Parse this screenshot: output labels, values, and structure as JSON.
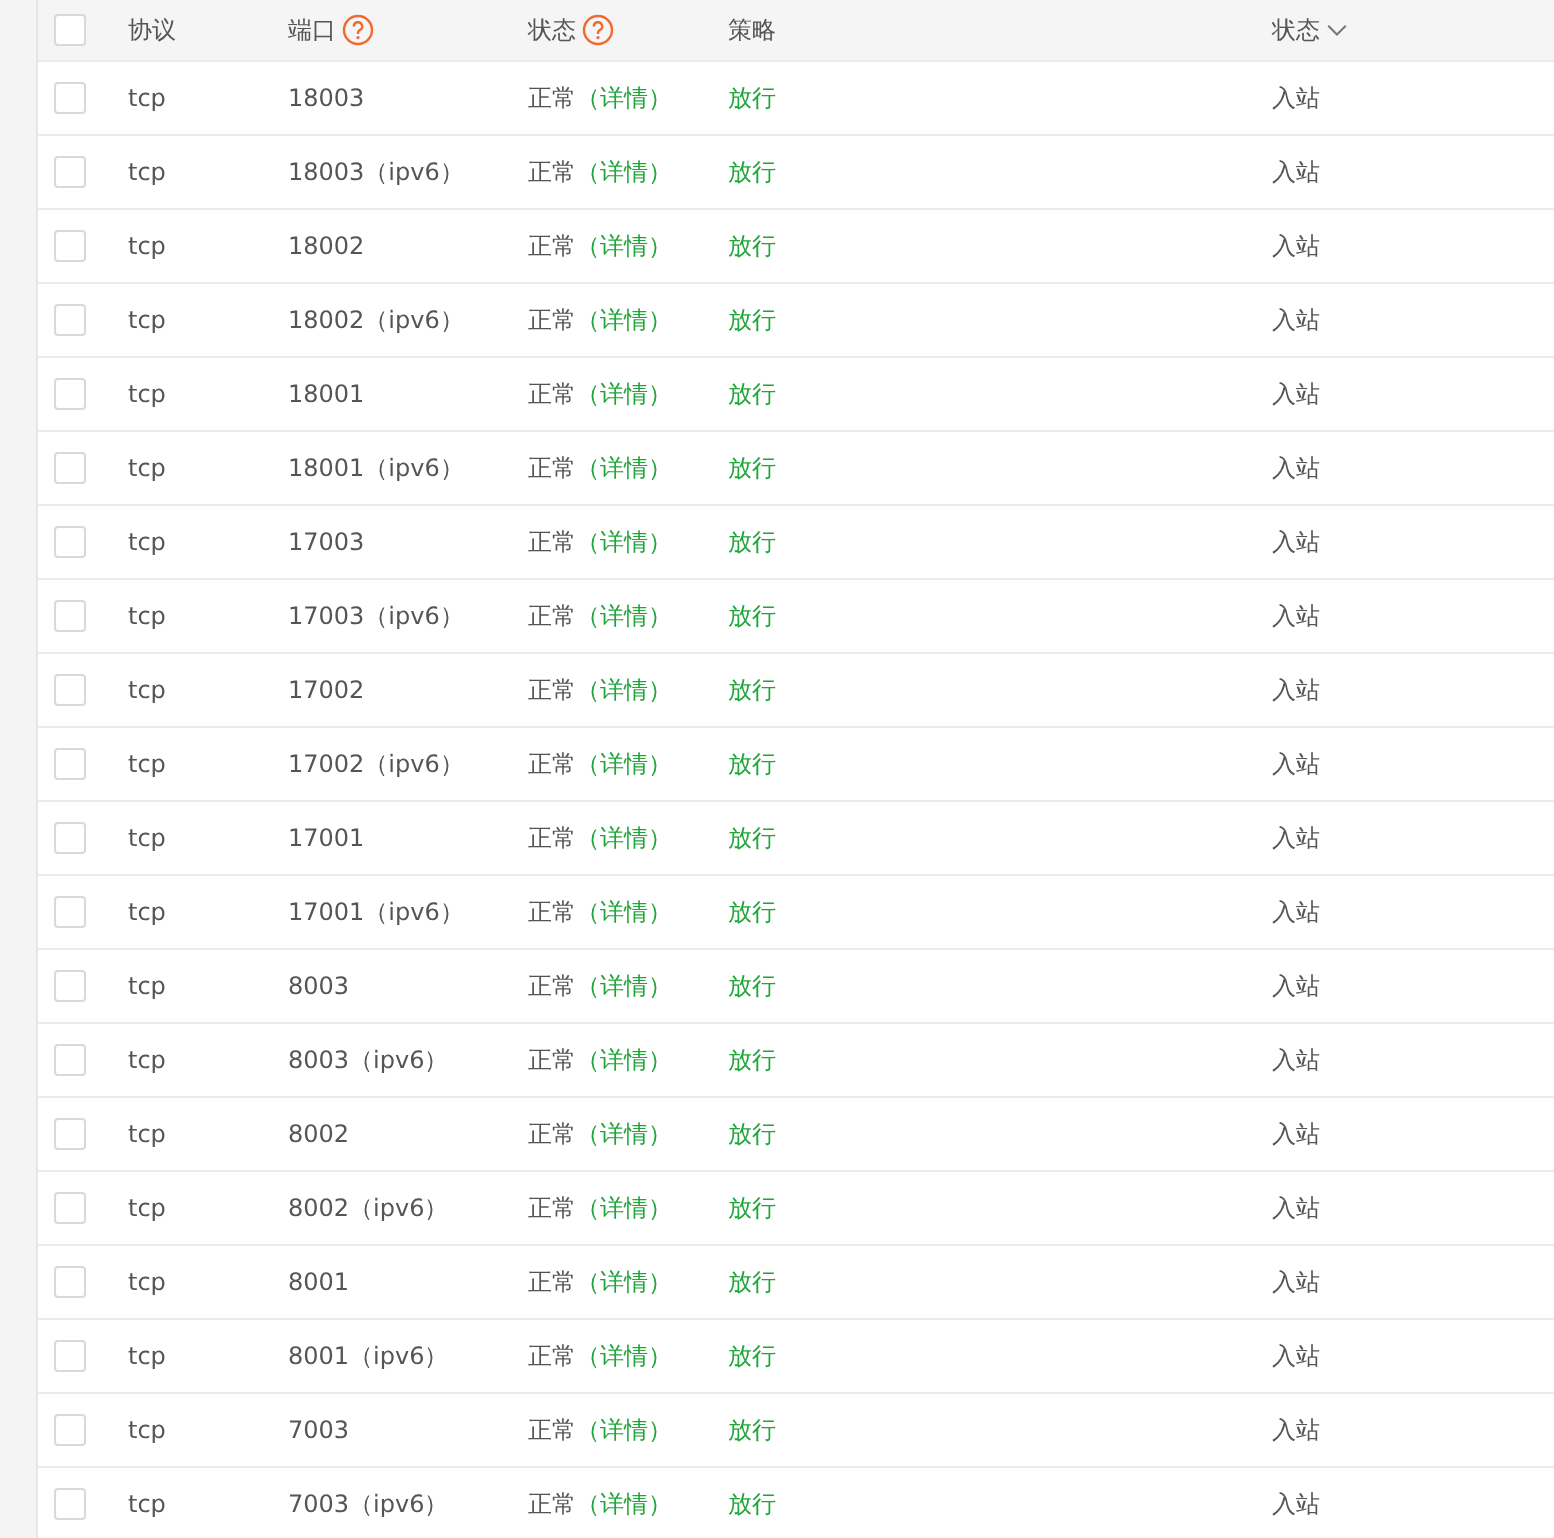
{
  "table": {
    "select_all": {
      "checked": false
    },
    "columns": [
      {
        "label": "协议",
        "kind": "plain"
      },
      {
        "label": "端口",
        "kind": "help"
      },
      {
        "label": "状态",
        "kind": "help"
      },
      {
        "label": "策略",
        "kind": "plain"
      },
      {
        "label": "状态",
        "kind": "sort"
      }
    ],
    "rows": [
      {
        "checked": false,
        "protocol": "tcp",
        "port": "18003",
        "status": "正常",
        "detail": "（详情）",
        "policy": "放行",
        "direction": "入站"
      },
      {
        "checked": false,
        "protocol": "tcp",
        "port": "18003（ipv6）",
        "status": "正常",
        "detail": "（详情）",
        "policy": "放行",
        "direction": "入站"
      },
      {
        "checked": false,
        "protocol": "tcp",
        "port": "18002",
        "status": "正常",
        "detail": "（详情）",
        "policy": "放行",
        "direction": "入站"
      },
      {
        "checked": false,
        "protocol": "tcp",
        "port": "18002（ipv6）",
        "status": "正常",
        "detail": "（详情）",
        "policy": "放行",
        "direction": "入站"
      },
      {
        "checked": false,
        "protocol": "tcp",
        "port": "18001",
        "status": "正常",
        "detail": "（详情）",
        "policy": "放行",
        "direction": "入站"
      },
      {
        "checked": false,
        "protocol": "tcp",
        "port": "18001（ipv6）",
        "status": "正常",
        "detail": "（详情）",
        "policy": "放行",
        "direction": "入站"
      },
      {
        "checked": false,
        "protocol": "tcp",
        "port": "17003",
        "status": "正常",
        "detail": "（详情）",
        "policy": "放行",
        "direction": "入站"
      },
      {
        "checked": false,
        "protocol": "tcp",
        "port": "17003（ipv6）",
        "status": "正常",
        "detail": "（详情）",
        "policy": "放行",
        "direction": "入站"
      },
      {
        "checked": false,
        "protocol": "tcp",
        "port": "17002",
        "status": "正常",
        "detail": "（详情）",
        "policy": "放行",
        "direction": "入站"
      },
      {
        "checked": false,
        "protocol": "tcp",
        "port": "17002（ipv6）",
        "status": "正常",
        "detail": "（详情）",
        "policy": "放行",
        "direction": "入站"
      },
      {
        "checked": false,
        "protocol": "tcp",
        "port": "17001",
        "status": "正常",
        "detail": "（详情）",
        "policy": "放行",
        "direction": "入站"
      },
      {
        "checked": false,
        "protocol": "tcp",
        "port": "17001（ipv6）",
        "status": "正常",
        "detail": "（详情）",
        "policy": "放行",
        "direction": "入站"
      },
      {
        "checked": false,
        "protocol": "tcp",
        "port": "8003",
        "status": "正常",
        "detail": "（详情）",
        "policy": "放行",
        "direction": "入站"
      },
      {
        "checked": false,
        "protocol": "tcp",
        "port": "8003（ipv6）",
        "status": "正常",
        "detail": "（详情）",
        "policy": "放行",
        "direction": "入站"
      },
      {
        "checked": false,
        "protocol": "tcp",
        "port": "8002",
        "status": "正常",
        "detail": "（详情）",
        "policy": "放行",
        "direction": "入站"
      },
      {
        "checked": false,
        "protocol": "tcp",
        "port": "8002（ipv6）",
        "status": "正常",
        "detail": "（详情）",
        "policy": "放行",
        "direction": "入站"
      },
      {
        "checked": false,
        "protocol": "tcp",
        "port": "8001",
        "status": "正常",
        "detail": "（详情）",
        "policy": "放行",
        "direction": "入站"
      },
      {
        "checked": false,
        "protocol": "tcp",
        "port": "8001（ipv6）",
        "status": "正常",
        "detail": "（详情）",
        "policy": "放行",
        "direction": "入站"
      },
      {
        "checked": false,
        "protocol": "tcp",
        "port": "7003",
        "status": "正常",
        "detail": "（详情）",
        "policy": "放行",
        "direction": "入站"
      },
      {
        "checked": false,
        "protocol": "tcp",
        "port": "7003（ipv6）",
        "status": "正常",
        "detail": "（详情）",
        "policy": "放行",
        "direction": "入站"
      }
    ]
  }
}
